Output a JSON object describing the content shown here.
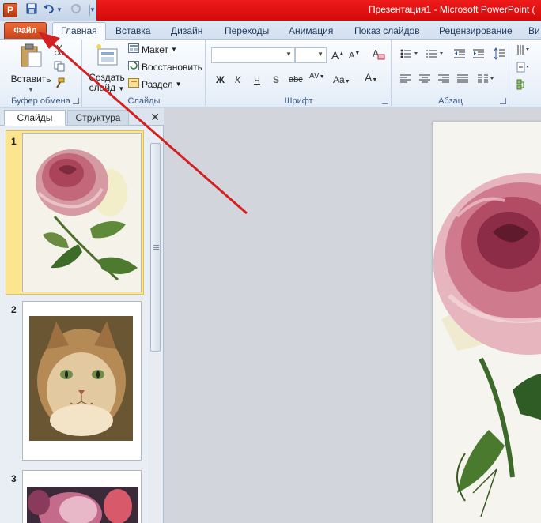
{
  "window": {
    "title": "Презентация1 - Microsoft PowerPoint ("
  },
  "qat": {
    "app_icon": "P",
    "save_icon": "save-icon",
    "undo_icon": "undo-icon",
    "redo_icon": "redo-icon"
  },
  "tabs": {
    "file": "Файл",
    "items": [
      "Главная",
      "Вставка",
      "Дизайн",
      "Переходы",
      "Анимация",
      "Показ слайдов",
      "Рецензирование",
      "Ви"
    ]
  },
  "ribbon": {
    "clipboard": {
      "label": "Буфер обмена",
      "paste": "Вставить"
    },
    "slides": {
      "label": "Слайды",
      "new_slide_line1": "Создать",
      "new_slide_line2": "слайд",
      "layout": "Макет",
      "reset": "Восстановить",
      "section": "Раздел"
    },
    "font": {
      "label": "Шрифт",
      "bold": "Ж",
      "italic": "К",
      "underline": "Ч",
      "shadow": "S",
      "strike": "abc",
      "spacing": "AV",
      "case": "Aa",
      "color": "A"
    },
    "paragraph": {
      "label": "Абзац"
    }
  },
  "panel": {
    "tab_slides": "Слайды",
    "tab_outline": "Структура",
    "slide_numbers": [
      "1",
      "2",
      "3"
    ]
  },
  "colors": {
    "file_tab": "#d6521f",
    "title_accent": "#e01212",
    "selection": "#fbe58f",
    "arrow": "#d42020"
  }
}
